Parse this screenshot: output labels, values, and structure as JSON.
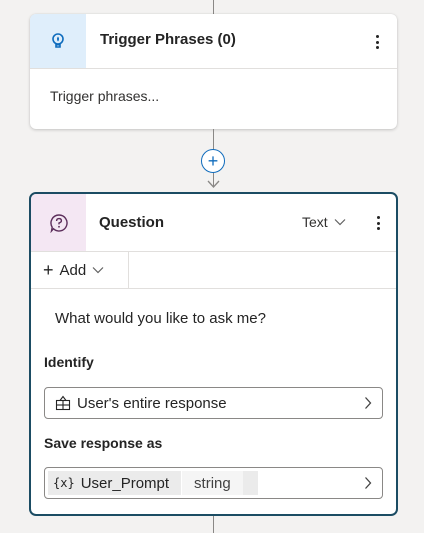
{
  "trigger": {
    "title": "Trigger Phrases (0)",
    "placeholder": "Trigger phrases...",
    "icon": "lightbulb-icon",
    "accent": "#dfeefb"
  },
  "connector": {
    "add_label": "+"
  },
  "question": {
    "title": "Question",
    "type": "Text",
    "icon": "question-bubble-icon",
    "accent": "#f4e7f3",
    "border_color": "#1b4c63",
    "add_label": "Add",
    "prompt": "What would you like to ask me?",
    "identify_label": "Identify",
    "identify_value": "User's entire response",
    "save_label": "Save response as",
    "variable": {
      "icon_text": "{x}",
      "name": "User_Prompt",
      "type": "string"
    }
  }
}
